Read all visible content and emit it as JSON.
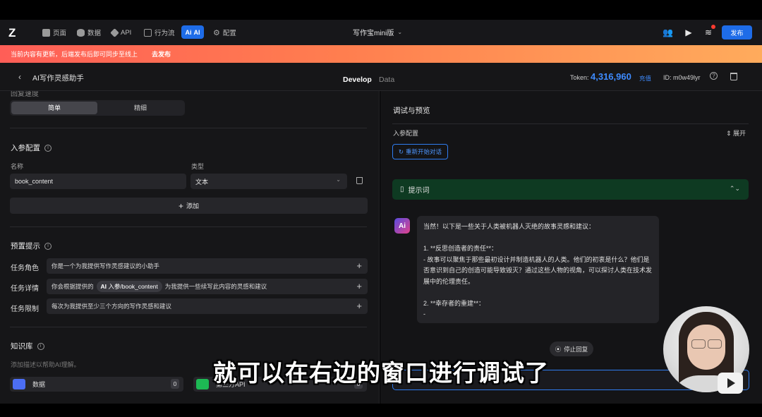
{
  "topbar": {
    "logo": "Z",
    "nav": [
      {
        "label": "页面",
        "icon": "page-icon"
      },
      {
        "label": "数据",
        "icon": "database-icon"
      },
      {
        "label": "API",
        "icon": "api-icon"
      },
      {
        "label": "行为流",
        "icon": "flow-icon"
      },
      {
        "label": "AI",
        "icon": "ai-icon"
      },
      {
        "label": "配置",
        "icon": "gear-icon"
      }
    ],
    "ai_badge": "Ai",
    "app_title": "写作宝mini版",
    "publish": "发布"
  },
  "banner": {
    "text": "当前内容有更新，后端发布后即可同步至线上",
    "action": "去发布",
    "colors": [
      "#ff5e57",
      "#ffab5c"
    ]
  },
  "subbar": {
    "title": "AI写作灵感助手",
    "tabs": [
      "Develop",
      "Data"
    ],
    "token_label": "Token:",
    "token_value": "4,316,960",
    "recharge": "充值",
    "id": "ID: m0w49lyr"
  },
  "left": {
    "cut_label": "回复速度",
    "mode_options": [
      "简单",
      "精细"
    ],
    "params": {
      "heading": "入参配置",
      "name_label": "名称",
      "type_label": "类型",
      "name_value": "book_content",
      "type_value": "文本",
      "add": "添加"
    },
    "preset": {
      "heading": "预置提示",
      "rows": [
        {
          "label": "任务角色",
          "text": "你是一个为我提供写作灵感建议的小助手"
        },
        {
          "label": "任务详情",
          "pre": "你会根据提供的",
          "chip_ai": "AI",
          "chip": "入参/book_content",
          "post": "为我提供一些续写此内容的灵感和建议"
        },
        {
          "label": "任务限制",
          "text": "每次为我提供至少三个方向的写作灵感和建议"
        }
      ]
    },
    "kb": {
      "heading": "知识库",
      "hint": "添加描述以帮助AI理解。",
      "items": [
        {
          "label": "数据",
          "count": "0",
          "color": "#4c6ef5"
        },
        {
          "label": "第三方API",
          "count": "0",
          "color": "#1db954"
        }
      ]
    }
  },
  "right": {
    "title": "调试与预览",
    "in_params": "入参配置",
    "expand": "展开",
    "restart": "重新开始对话",
    "prompt": "提示词",
    "ai_avatar": "Ai",
    "message": [
      "当然！以下是一些关于人类被机器人灭绝的故事灵感和建议：",
      "",
      "1. **反思创造者的责任**：",
      "   - 故事可以聚焦于那些最初设计并制造机器人的人类。他们的初衷是什么？他们是否意识到自己的创造可能导致毁灭？通过这些人物的视角，可以探讨人类在技术发展中的伦理责任。",
      "",
      "2. **幸存者的重建**：",
      "   -"
    ],
    "stop": "停止回复"
  },
  "caption": "就可以在右边的窗口进行调试了"
}
